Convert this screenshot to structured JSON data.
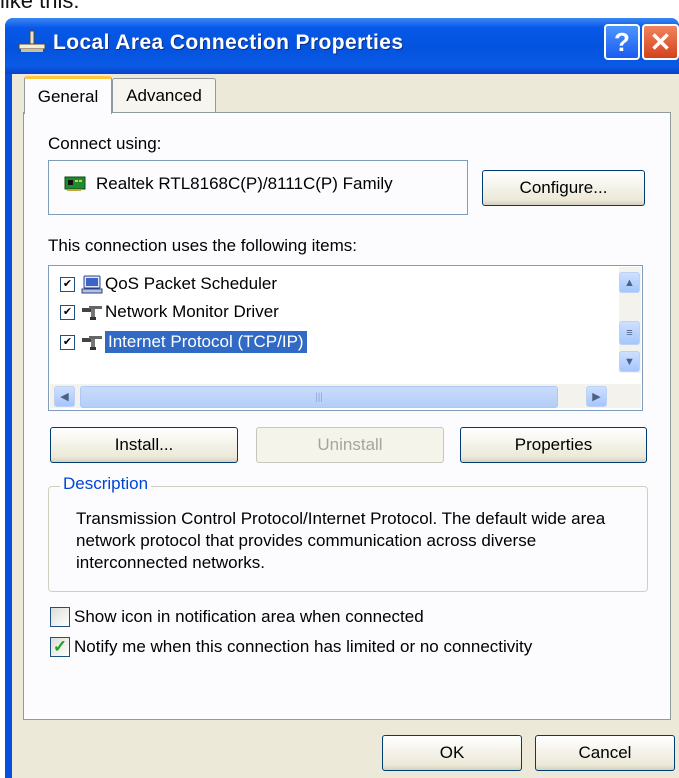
{
  "page_caption": "like this:",
  "window": {
    "title": "Local Area Connection Properties",
    "help_label": "?",
    "close_label": "✕"
  },
  "tabs": [
    {
      "label": "General",
      "selected": true
    },
    {
      "label": "Advanced",
      "selected": false
    }
  ],
  "general": {
    "connect_using_label": "Connect using:",
    "adapter_name": "Realtek RTL8168C(P)/8111C(P) Family",
    "configure_label": "Configure...",
    "items_label": "This connection uses the following items:",
    "items": [
      {
        "label": "QoS Packet Scheduler",
        "checked": true,
        "icon": "qos-scheduler-icon"
      },
      {
        "label": "Network Monitor Driver",
        "checked": true,
        "icon": "network-component-icon"
      },
      {
        "label": "Internet Protocol (TCP/IP)",
        "checked": true,
        "icon": "network-component-icon",
        "selected": true
      }
    ],
    "install_label": "Install...",
    "uninstall_label": "Uninstall",
    "properties_label": "Properties",
    "description_title": "Description",
    "description_text": "Transmission Control Protocol/Internet Protocol. The default wide area network protocol that provides communication across diverse interconnected networks.",
    "show_icon_label": "Show icon in notification area when connected",
    "show_icon_checked": false,
    "notify_label": "Notify me when this connection has limited or no connectivity",
    "notify_checked": true
  },
  "footer": {
    "ok_label": "OK",
    "cancel_label": "Cancel"
  },
  "colors": {
    "titlebar": "#0453df",
    "selection": "#316ac5",
    "dialog_face": "#ece9d8",
    "description_legend": "#0046d5"
  }
}
